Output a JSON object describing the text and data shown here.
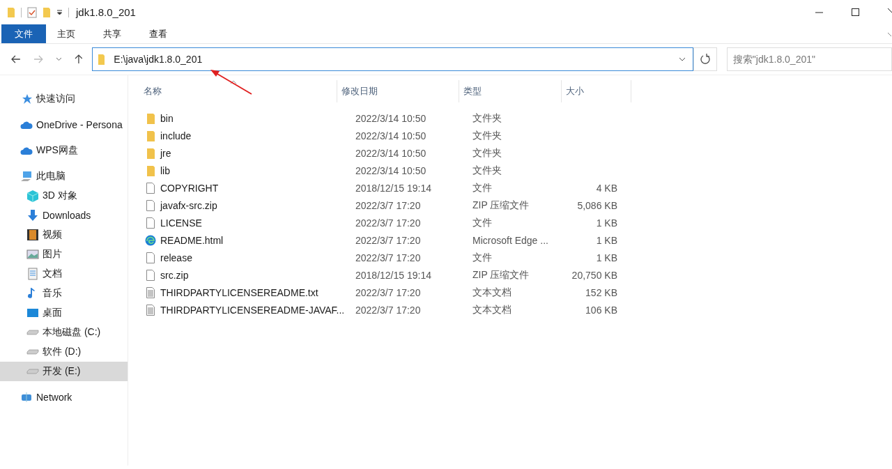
{
  "window": {
    "title": "jdk1.8.0_201"
  },
  "ribbon_tabs": [
    {
      "label": "文件",
      "selected": true
    },
    {
      "label": "主页",
      "selected": false
    },
    {
      "label": "共享",
      "selected": false
    },
    {
      "label": "查看",
      "selected": false
    }
  ],
  "address_bar": {
    "value": "E:\\java\\jdk1.8.0_201"
  },
  "search": {
    "placeholder": "搜索\"jdk1.8.0_201\""
  },
  "sidebar": {
    "items": [
      {
        "label": "快速访问",
        "kind": "star",
        "selected": false
      },
      {
        "label": "OneDrive - Persona",
        "kind": "cloud",
        "selected": false
      },
      {
        "label": "WPS网盘",
        "kind": "cloud",
        "selected": false
      },
      {
        "label": "此电脑",
        "kind": "computer",
        "selected": false,
        "children": [
          {
            "label": "3D 对象",
            "kind": "cube",
            "selected": false
          },
          {
            "label": "Downloads",
            "kind": "download",
            "selected": false
          },
          {
            "label": "视频",
            "kind": "film",
            "selected": false
          },
          {
            "label": "图片",
            "kind": "picture",
            "selected": false
          },
          {
            "label": "文档",
            "kind": "document",
            "selected": false
          },
          {
            "label": "音乐",
            "kind": "music",
            "selected": false
          },
          {
            "label": "桌面",
            "kind": "desktop",
            "selected": false
          },
          {
            "label": "本地磁盘 (C:)",
            "kind": "drive",
            "selected": false
          },
          {
            "label": "软件 (D:)",
            "kind": "drive",
            "selected": false
          },
          {
            "label": "开发 (E:)",
            "kind": "drive",
            "selected": true
          }
        ]
      },
      {
        "label": "Network",
        "kind": "network",
        "selected": false
      }
    ]
  },
  "table": {
    "columns": [
      {
        "label": "名称",
        "sorted": true
      },
      {
        "label": "修改日期",
        "sorted": false
      },
      {
        "label": "类型",
        "sorted": false
      },
      {
        "label": "大小",
        "sorted": false
      }
    ],
    "rows": [
      {
        "kind": "folder",
        "name": "bin",
        "date": "2022/3/14 10:50",
        "type": "文件夹"
      },
      {
        "kind": "folder",
        "name": "include",
        "date": "2022/3/14 10:50",
        "type": "文件夹"
      },
      {
        "kind": "folder",
        "name": "jre",
        "date": "2022/3/14 10:50",
        "type": "文件夹"
      },
      {
        "kind": "folder",
        "name": "lib",
        "date": "2022/3/14 10:50",
        "type": "文件夹"
      },
      {
        "kind": "file",
        "name": "COPYRIGHT",
        "date": "2018/12/15 19:14",
        "type": "文件",
        "size": "4 KB"
      },
      {
        "kind": "file",
        "name": "javafx-src.zip",
        "date": "2022/3/7 17:20",
        "type": "ZIP 压缩文件",
        "size": "5,086 KB"
      },
      {
        "kind": "file",
        "name": "LICENSE",
        "date": "2022/3/7 17:20",
        "type": "文件",
        "size": "1 KB"
      },
      {
        "kind": "edge",
        "name": "README.html",
        "date": "2022/3/7 17:20",
        "type": "Microsoft Edge ...",
        "size": "1 KB"
      },
      {
        "kind": "file",
        "name": "release",
        "date": "2022/3/7 17:20",
        "type": "文件",
        "size": "1 KB"
      },
      {
        "kind": "file",
        "name": "src.zip",
        "date": "2018/12/15 19:14",
        "type": "ZIP 压缩文件",
        "size": "20,750 KB"
      },
      {
        "kind": "text",
        "name": "THIRDPARTYLICENSEREADME.txt",
        "date": "2022/3/7 17:20",
        "type": "文本文档",
        "size": "152 KB"
      },
      {
        "kind": "text",
        "name": "THIRDPARTYLICENSEREADME-JAVAF...",
        "date": "2022/3/7 17:20",
        "type": "文本文档",
        "size": "106 KB"
      }
    ]
  }
}
